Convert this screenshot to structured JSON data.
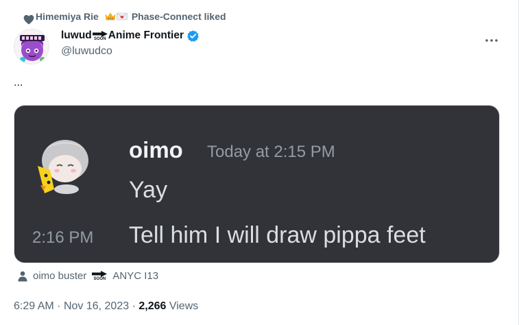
{
  "social_context": {
    "liker": "Himemiya Rie",
    "other": "Phase-Connect liked"
  },
  "author": {
    "name_part1": "luwud",
    "soon_label": "SOON",
    "name_part2": "Anime Frontier",
    "handle": "@luwudco"
  },
  "post": {
    "text": "..."
  },
  "discord_embed": {
    "username": "oimo",
    "timestamp": "Today at 2:15 PM",
    "message1": "Yay",
    "message2_time": "2:16 PM",
    "message2": "Tell him I will draw pippa feet"
  },
  "tag_row": {
    "tagged_user": "oimo buster",
    "soon_label": "SOON",
    "suffix": "ANYC I13"
  },
  "meta": {
    "time": "6:29 AM",
    "date": "Nov 16, 2023",
    "views_count": "2,266",
    "views_label": "Views"
  },
  "colors": {
    "accent_verified": "#1d9bf0",
    "text_secondary": "#536471",
    "discord_bg": "#313338"
  },
  "icons": [
    "heart-icon",
    "crown-emoji-icon",
    "love-letter-emoji-icon",
    "verified-badge-icon",
    "more-options-icon",
    "arrow-soon-icon",
    "person-icon"
  ]
}
